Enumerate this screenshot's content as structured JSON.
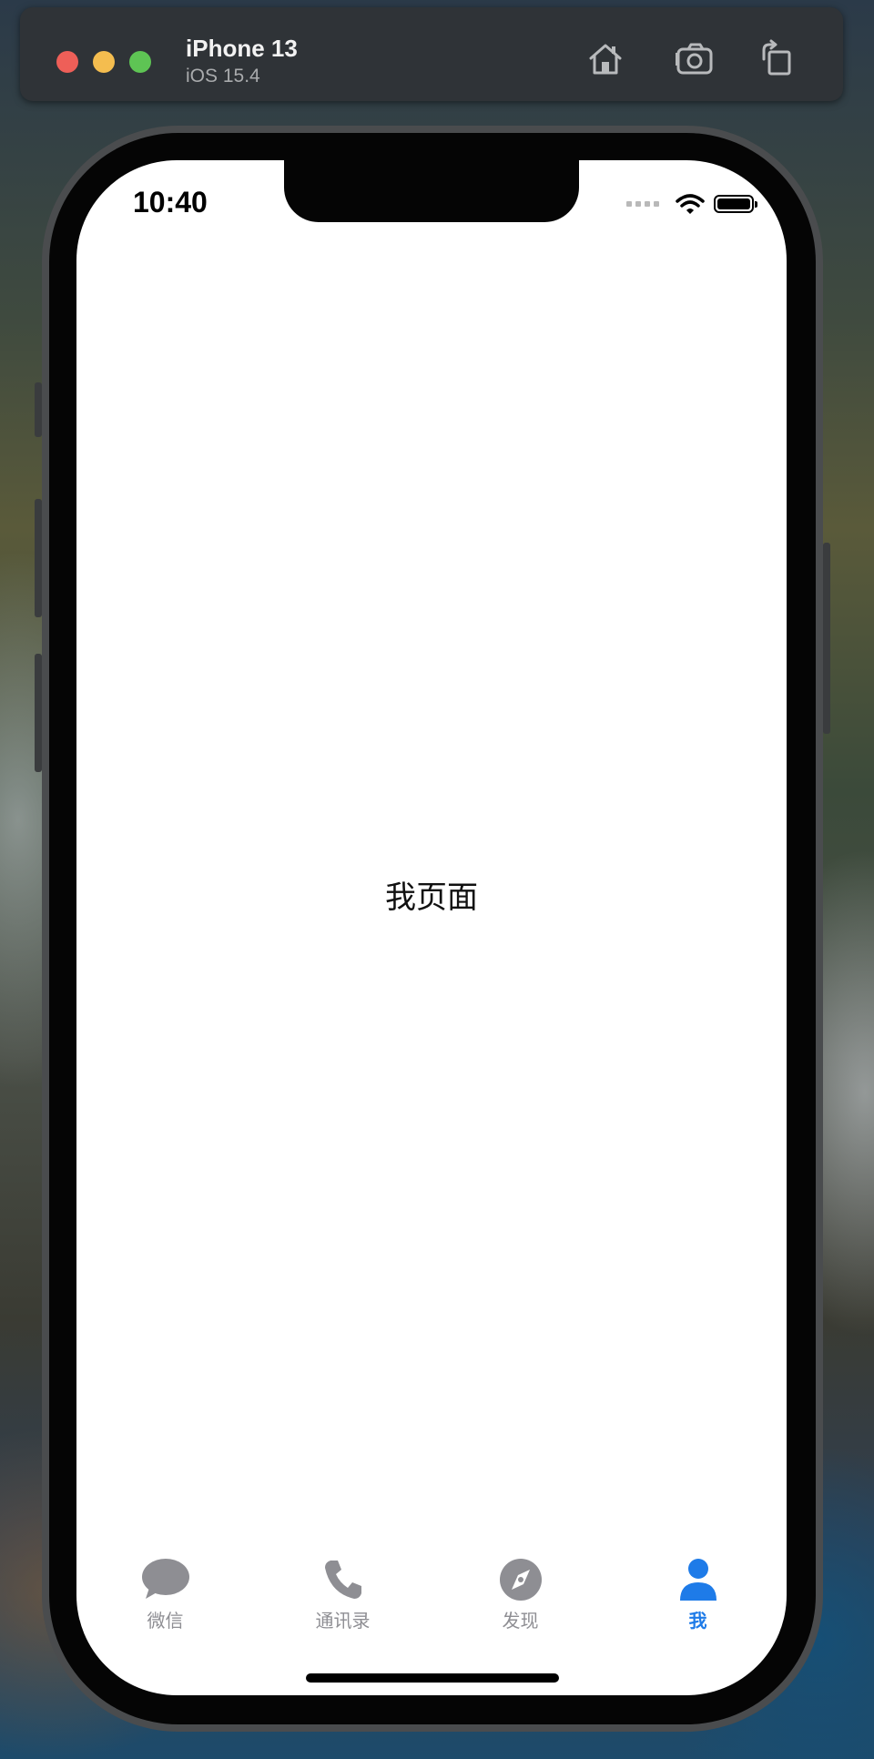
{
  "simulator": {
    "device_name": "iPhone 13",
    "os_version": "iOS 15.4",
    "buttons": {
      "home_icon": "home-icon",
      "screenshot_icon": "camera-icon",
      "rotate_icon": "rotate-icon"
    }
  },
  "status_bar": {
    "time": "10:40"
  },
  "main": {
    "page_label": "我页面"
  },
  "tabbar": {
    "items": [
      {
        "label": "微信",
        "icon": "chat-bubble-icon",
        "active": false
      },
      {
        "label": "通讯录",
        "icon": "phone-icon",
        "active": false
      },
      {
        "label": "发现",
        "icon": "compass-icon",
        "active": false
      },
      {
        "label": "我",
        "icon": "person-icon",
        "active": true
      }
    ],
    "active_color": "#1e7be8",
    "inactive_color": "#8e8e93"
  }
}
